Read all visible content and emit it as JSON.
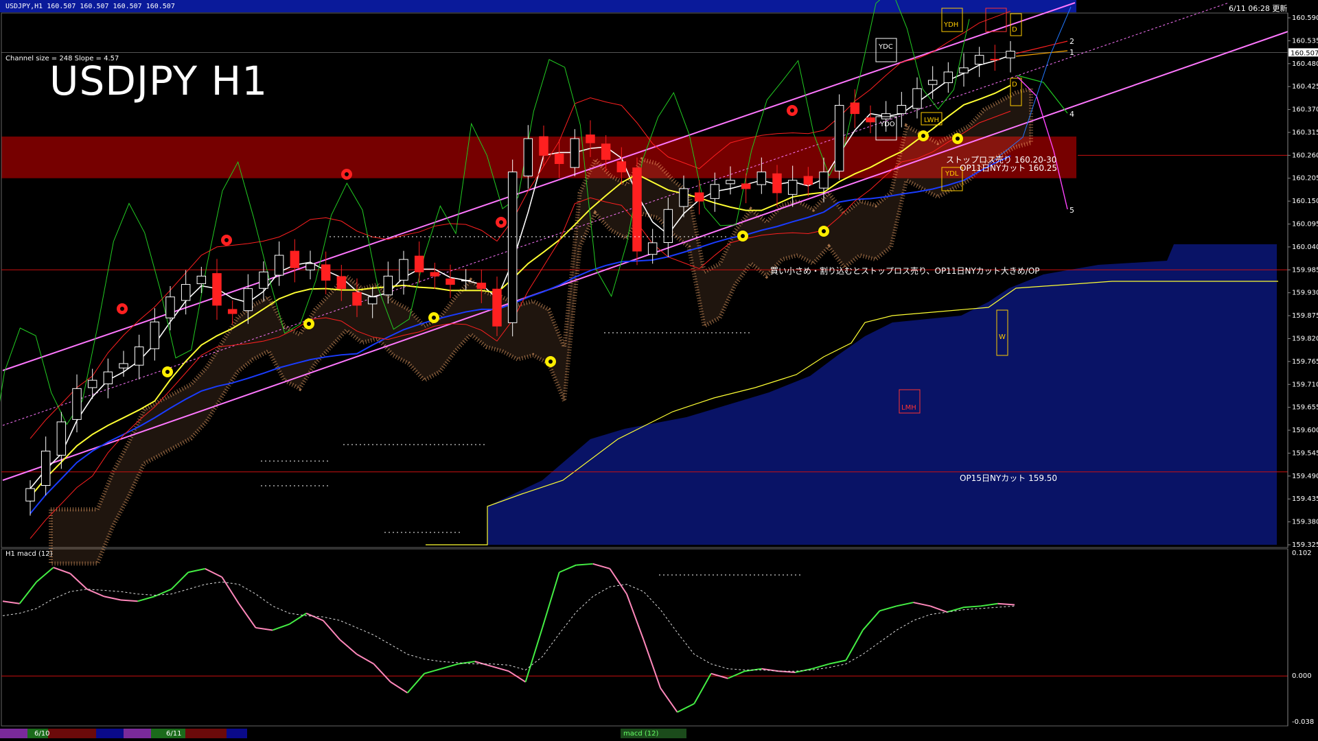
{
  "header": {
    "symbol_line": "USDJPY,H1  160.507 160.507 160.507 160.507",
    "channel_info": "Channel size = 248 Slope = 4.57",
    "big_title": "USDJPY H1",
    "datetime": "6/11 06:28 更新"
  },
  "macd_label": "H1  macd (12)",
  "annotations": {
    "ydh": "YDH",
    "ydc": "YDC",
    "ydo": "YDO",
    "ydl": "YDL",
    "lwh": "LWH",
    "lmh": "LMH",
    "w": "W",
    "d_top": "D",
    "d_bottom": "D",
    "stoploss": "ストップロス売り 160.20-30",
    "op11": "OP11日NYカット 160.25",
    "comment": "買い小さめ・割り込むとストップロス売り、OP11日NYカット大きめ/OP",
    "op15": "OP15日NYカット 159.50",
    "wave_labels": [
      "2",
      "1",
      "4",
      "5"
    ]
  },
  "bottom_bar": {
    "date_labels": [
      "6/10",
      "6/11"
    ],
    "indicator": "macd (12)"
  },
  "chart_data": [
    {
      "type": "line",
      "title": "USDJPY H1",
      "subtitle": "Channel size = 248 Slope = 4.57",
      "price_ticks": [
        160.59,
        160.535,
        160.48,
        160.425,
        160.37,
        160.315,
        160.26,
        160.205,
        160.15,
        160.095,
        160.04,
        159.985,
        159.93,
        159.875,
        159.82,
        159.765,
        159.71,
        159.655,
        159.6,
        159.545,
        159.49,
        159.435,
        159.38,
        159.325
      ],
      "current_price": 160.507,
      "ylim": [
        159.3,
        160.62
      ],
      "levels": [
        {
          "label": "ストップロス売り 160.20-30",
          "value": 160.25
        },
        {
          "label": "OP11日NYカット 160.25",
          "value": 160.25
        },
        {
          "label": "OP15日NYカット 159.50",
          "value": 159.5
        }
      ],
      "stoploss_zone": [
        160.205,
        160.305
      ],
      "x_dates": [
        "6/10",
        "6/11"
      ],
      "series": [
        {
          "values": [
            159.46,
            159.55,
            159.62,
            159.7,
            159.72,
            159.74,
            159.76,
            159.8,
            159.86,
            159.92,
            159.95,
            159.97,
            159.9,
            159.88,
            159.94,
            159.98,
            160.02,
            159.99,
            160.0,
            159.96,
            159.94,
            159.9,
            159.92,
            159.97,
            160.01,
            159.98,
            159.97,
            159.95,
            159.96,
            159.94,
            159.85,
            160.22,
            160.3,
            160.26,
            160.24,
            160.3,
            160.29,
            160.25,
            160.22,
            160.03,
            160.05,
            160.13,
            160.18,
            160.15,
            160.19,
            160.2,
            160.18,
            160.22,
            160.17,
            160.2,
            160.19,
            160.22,
            160.38,
            160.36,
            160.34,
            160.36,
            160.38,
            160.42,
            160.44,
            160.46,
            160.47,
            160.5,
            160.49,
            160.51
          ]
        }
      ]
    },
    {
      "type": "line",
      "title": "H1  macd (12)",
      "ylim": [
        -0.038,
        0.102
      ],
      "ticks": [
        0.102,
        0.0,
        -0.038
      ],
      "series": [
        {
          "values": [
            0.062,
            0.06,
            0.078,
            0.09,
            0.085,
            0.072,
            0.066,
            0.063,
            0.062,
            0.066,
            0.072,
            0.086,
            0.089,
            0.082,
            0.06,
            0.04,
            0.038,
            0.043,
            0.052,
            0.046,
            0.03,
            0.018,
            0.01,
            -0.005,
            -0.014,
            0.002,
            0.006,
            0.01,
            0.012,
            0.008,
            0.004,
            -0.005,
            0.04,
            0.086,
            0.092,
            0.093,
            0.089,
            0.068,
            0.03,
            -0.01,
            -0.03,
            -0.023,
            0.002,
            -0.002,
            0.004,
            0.006,
            0.004,
            0.003,
            0.006,
            0.01,
            0.013,
            0.038,
            0.054,
            0.058,
            0.061,
            0.058,
            0.053,
            0.057,
            0.058,
            0.06,
            0.059
          ]
        },
        {
          "values": [
            0.05,
            0.052,
            0.056,
            0.064,
            0.07,
            0.072,
            0.071,
            0.07,
            0.068,
            0.067,
            0.068,
            0.072,
            0.076,
            0.078,
            0.076,
            0.068,
            0.058,
            0.052,
            0.05,
            0.049,
            0.046,
            0.04,
            0.034,
            0.026,
            0.018,
            0.014,
            0.012,
            0.011,
            0.01,
            0.01,
            0.009,
            0.005,
            0.016,
            0.035,
            0.053,
            0.066,
            0.074,
            0.076,
            0.07,
            0.055,
            0.036,
            0.018,
            0.01,
            0.006,
            0.005,
            0.005,
            0.004,
            0.004,
            0.005,
            0.007,
            0.01,
            0.018,
            0.028,
            0.038,
            0.046,
            0.051,
            0.053,
            0.055,
            0.056,
            0.057,
            0.058
          ]
        }
      ]
    }
  ],
  "colors": {
    "background": "#000000",
    "header_band": "#0a1a9a",
    "stoploss_zone": "#8b0000",
    "channel": "#ff77ff",
    "ma_fast": "#ffffff",
    "ma_mid": "#ffff33",
    "ma_slow": "#1a3cff",
    "bb_upper": "#ff2020",
    "chikou": "#22cc22",
    "cloud_up": "#ffb070",
    "cloud_down": "#2244ff",
    "candle_up": "#ffffff",
    "candle_down": "#ff2020",
    "level_line": "#cc1111",
    "macd_up": "#44ee44",
    "macd_down": "#ff88bb",
    "signal": "#dddddd"
  }
}
